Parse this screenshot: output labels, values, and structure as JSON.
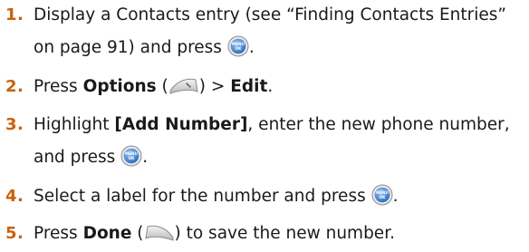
{
  "steps": [
    {
      "number": "1.",
      "line1": "Display a Contacts entry (see “Finding Contacts Entries”",
      "line2_a": "on page 91) and press",
      "line2_b": "."
    },
    {
      "number": "2.",
      "pre": "Press",
      "bold1": "Options",
      "mid": " (",
      "post": ") >",
      "bold2": "Edit",
      "end": "."
    },
    {
      "number": "3.",
      "pre": "Highlight",
      "bold1": "[Add Number]",
      "rest": ", enter the new phone number,",
      "line2_a": "and press",
      "line2_b": "."
    },
    {
      "number": "4.",
      "text": "Select a label for the number and press",
      "end": "."
    },
    {
      "number": "5.",
      "pre": "Press",
      "bold1": "Done",
      "mid": " (",
      "post": ") to save the new number."
    }
  ],
  "icons": {
    "menu_ok_button": {
      "name": "menu-ok-button-icon",
      "text_top": "MENU",
      "text_bottom": "OK",
      "color": "#3b7fd0"
    },
    "right_softkey": {
      "name": "right-softkey-icon"
    },
    "left_softkey": {
      "name": "left-softkey-icon"
    }
  },
  "colors": {
    "step_number": "#c9610a",
    "text": "#1a1a1a"
  }
}
